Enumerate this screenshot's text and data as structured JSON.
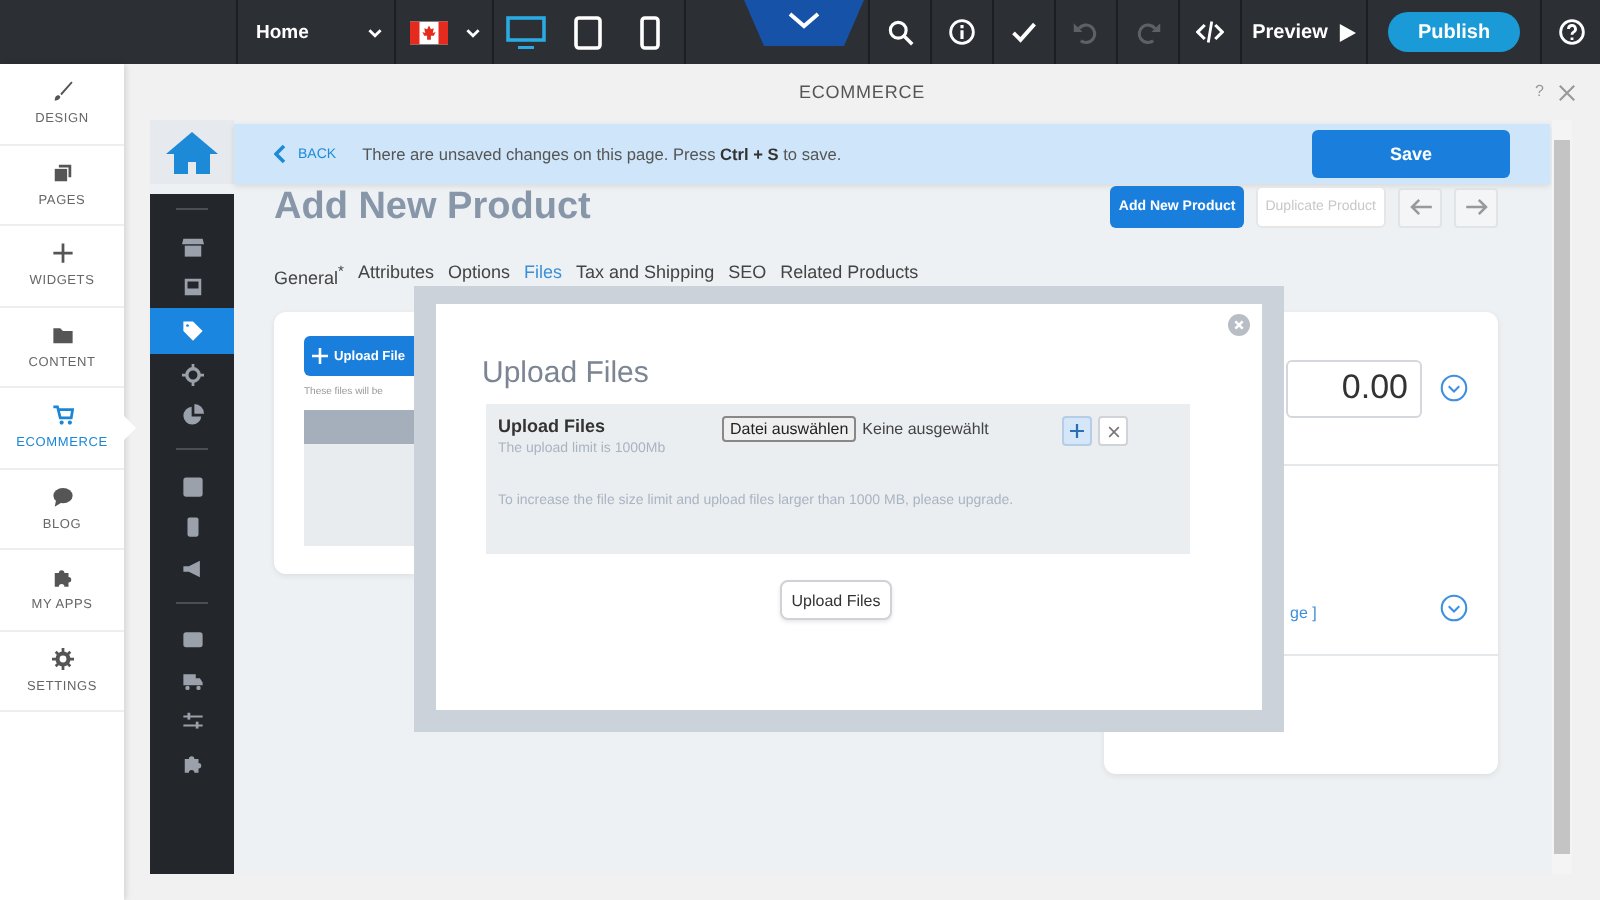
{
  "topbar": {
    "page_select": "Home",
    "devices": [
      {
        "kind": "desktop",
        "selected": true
      },
      {
        "kind": "tablet",
        "selected": false
      },
      {
        "kind": "phone",
        "selected": false
      }
    ],
    "tools": [
      {
        "kind": "search",
        "disabled": false
      },
      {
        "kind": "info",
        "disabled": false
      },
      {
        "kind": "check",
        "disabled": false
      },
      {
        "kind": "undo",
        "disabled": true
      },
      {
        "kind": "redo",
        "disabled": true
      },
      {
        "kind": "code",
        "disabled": false
      }
    ],
    "preview": "Preview",
    "publish": "Publish"
  },
  "sidebar": {
    "items": [
      {
        "label": "DESIGN",
        "selected": false
      },
      {
        "label": "PAGES",
        "selected": false
      },
      {
        "label": "WIDGETS",
        "selected": false
      },
      {
        "label": "CONTENT",
        "selected": false
      },
      {
        "label": "ECOMMERCE",
        "selected": true
      },
      {
        "label": "BLOG",
        "selected": false
      },
      {
        "label": "MY APPS",
        "selected": false
      },
      {
        "label": "SETTINGS",
        "selected": false
      }
    ]
  },
  "panel": {
    "title": "ECOMMERCE",
    "help": "?"
  },
  "notice": {
    "back": "BACK",
    "message": "There are unsaved changes on this page. Press **Ctrl + S** to save.",
    "save": "Save"
  },
  "strip": {
    "groups": [
      [
        {
          "selected": false
        },
        {
          "selected": false
        },
        {
          "selected": true
        },
        {
          "selected": false
        },
        {
          "selected": false
        }
      ],
      [
        {
          "selected": false
        },
        {
          "selected": false
        },
        {
          "selected": false
        }
      ],
      [
        {
          "selected": false
        },
        {
          "selected": false
        },
        {
          "selected": false
        },
        {
          "selected": false
        }
      ]
    ]
  },
  "product": {
    "title": "Add New Product",
    "actions": [
      {
        "label": "Add New Product",
        "kind": "primary",
        "disabled": false
      },
      {
        "label": "Duplicate Product",
        "kind": "secondary",
        "disabled": true
      }
    ],
    "tabs": [
      {
        "label": "General$^{*}$",
        "selected": false
      },
      {
        "label": "Attributes",
        "selected": false
      },
      {
        "label": "Options",
        "selected": false
      },
      {
        "label": "Files",
        "selected": true
      },
      {
        "label": "Tax and Shipping",
        "selected": false
      },
      {
        "label": "SEO",
        "selected": false
      },
      {
        "label": "Related Products",
        "selected": false
      }
    ],
    "left_card": {
      "upload_button": "Upload File",
      "note": "These files will be"
    },
    "right_card": {
      "price": "0.00",
      "link": "ge ]"
    }
  },
  "modal": {
    "title": "Upload Files",
    "section_title": "Upload Files",
    "limit_note": "The upload limit is 1000Mb",
    "choose_button": "Datei auswählen",
    "no_file": "Keine ausgewählt",
    "upgrade_note": "To increase the file size limit and upload files larger than 1000 MB, please upgrade.",
    "upload_button": "Upload Files"
  }
}
